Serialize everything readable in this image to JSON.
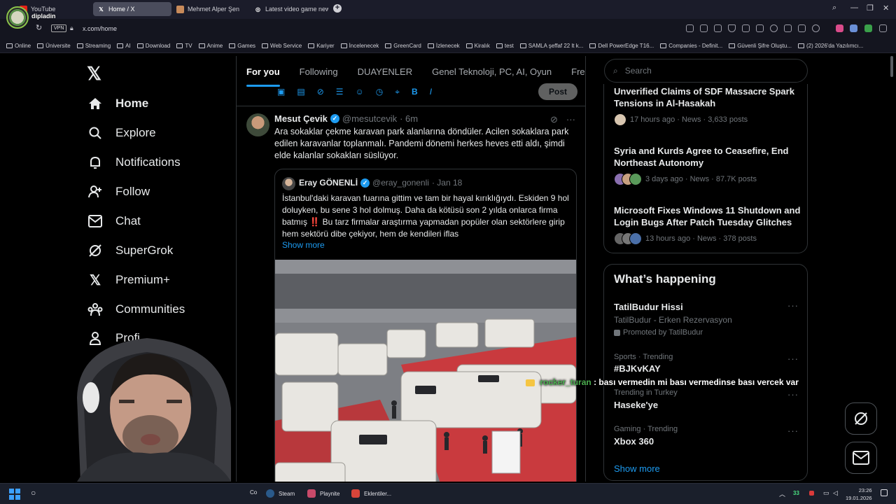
{
  "browser": {
    "tabs": [
      {
        "label": "YouTube",
        "active": false
      },
      {
        "label": "Home / X",
        "active": true
      },
      {
        "label": "Mehmet Alper Şen",
        "active": false
      },
      {
        "label": "Latest video game news",
        "active": false
      }
    ],
    "vpn_label": "VPN",
    "url": "x.com/home",
    "bookmarks": [
      "Online",
      "Üniversite",
      "Streaming",
      "AI",
      "Download",
      "TV",
      "Anime",
      "Games",
      "Web Service",
      "Kariyer",
      "İncelenecek",
      "GreenCard",
      "İzlenecek",
      "Kiralık",
      "test",
      "SAMLA şeffaf 22 lt k...",
      "Dell PowerEdge T16...",
      "Companies - Definit...",
      "Güvenli Şifre Oluştu...",
      "(2) 2026'da Yazılımcı..."
    ]
  },
  "stream": {
    "streamer": "dipladin",
    "chat_user": "rocker_turan",
    "chat_message": ": bası vermedin mi bası vermedinse bası vercek var"
  },
  "nav": {
    "items": [
      {
        "label": "Home",
        "icon": "home-icon"
      },
      {
        "label": "Explore",
        "icon": "search-icon"
      },
      {
        "label": "Notifications",
        "icon": "bell-icon"
      },
      {
        "label": "Follow",
        "icon": "follow-icon"
      },
      {
        "label": "Chat",
        "icon": "mail-icon"
      },
      {
        "label": "SuperGrok",
        "icon": "grok-icon"
      },
      {
        "label": "Premium+",
        "icon": "x-icon"
      },
      {
        "label": "Communities",
        "icon": "communities-icon"
      },
      {
        "label": "Profi",
        "icon": "profile-icon"
      }
    ]
  },
  "timeline": {
    "tabs": [
      "For you",
      "Following",
      "DUAYENLER",
      "Genel Teknoloji, PC, AI, Oyun",
      "Free G"
    ],
    "post_button": "Post",
    "tweet": {
      "name": "Mesut Çevik",
      "handle": "@mesutcevik",
      "time": "· 6m",
      "text": "Ara sokaklar çekme karavan park alanlarına döndüler. Acilen sokaklara park edilen karavanlar toplanmalı. Pandemi dönemi herkes heves etti aldı, şimdi elde kalanlar sokakları süslüyor.",
      "quote": {
        "name": "Eray GÖNENLİ",
        "handle": "@eray_gonenli",
        "time": "· Jan 18",
        "text": "İstanbul'daki karavan fuarına gittim ve tam bir hayal kırıklığıydı. Eskiden 9 hol doluyken, bu sene 3 hol dolmuş. Daha da kötüsü son 2 yılda onlarca firma batmış ‼️ Bu tarz firmalar araştırma yapmadan popüler olan sektörlere girip hem sektörü dibe çekiyor, hem de kendileri iflas",
        "show_more": "Show more"
      }
    }
  },
  "sidebar": {
    "search_placeholder": "Search",
    "news": [
      {
        "title": "Unverified Claims of SDF Massacre Spark Tensions in Al-Hasakah",
        "meta": "17 hours ago · News · 3,633 posts"
      },
      {
        "title": "Syria and Kurds Agree to Ceasefire, End Northeast Autonomy",
        "meta": "3 days ago · News · 87.7K posts"
      },
      {
        "title": "Microsoft Fixes Windows 11 Shutdown and Login Bugs After Patch Tuesday Glitches",
        "meta": "13 hours ago · News · 378 posts"
      }
    ],
    "happening_title": "What’s happening",
    "promoted": {
      "name": "TatilBudur Hissi",
      "sub": "TatilBudur - Erken Rezervasyon",
      "label": "Promoted by TatilBudur"
    },
    "trends": [
      {
        "meta": "Sports · Trending",
        "name": "#BJKvKAY"
      },
      {
        "meta": "Trending in Turkey",
        "name": "Haseke'ye"
      },
      {
        "meta": "Gaming · Trending",
        "name": "Xbox 360"
      }
    ],
    "show_more": "Show more"
  },
  "taskbar": {
    "items": [
      "Co",
      "Steam",
      "Playnite",
      "Eklentiler..."
    ],
    "tray_count": "33",
    "time": "23:26",
    "date": "19.01.2026"
  },
  "colors": {
    "accent": "#1d9bf0",
    "background": "#000000",
    "chat_user": "#4caf50"
  }
}
